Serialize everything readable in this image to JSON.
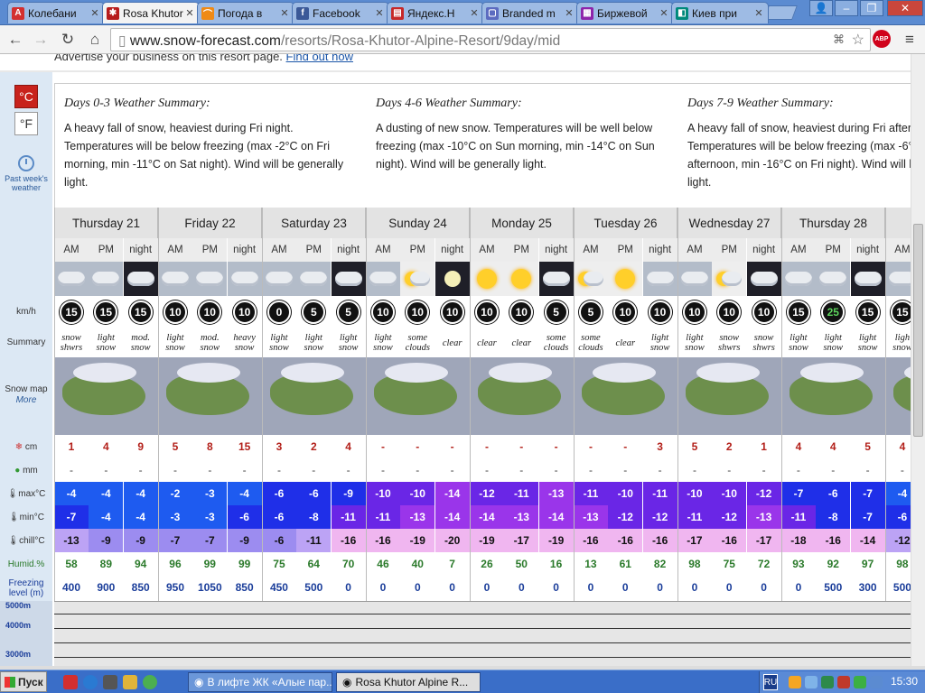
{
  "browser": {
    "tabs": [
      {
        "title": "Колебани",
        "icon": "A",
        "color": "#d32f2f"
      },
      {
        "title": "Rosa Khutor",
        "icon": "✱",
        "color": "#b71c1c"
      },
      {
        "title": "Погода в",
        "icon": "⌒",
        "color": "#ef8a16"
      },
      {
        "title": "Facebook",
        "icon": "f",
        "color": "#3b5998"
      },
      {
        "title": "Яндекс.Н",
        "icon": "▤",
        "color": "#c62828"
      },
      {
        "title": "Branded m",
        "icon": "▢",
        "color": "#5c6bc0"
      },
      {
        "title": "Биржевой",
        "icon": "▦",
        "color": "#8e24aa"
      },
      {
        "title": "Киев при",
        "icon": "◧",
        "color": "#00897b"
      }
    ],
    "url_main": "www.snow-forecast.com",
    "url_path": "/resorts/Rosa-Khutor-Alpine-Resort/9day/mid",
    "window_buttons": [
      "👤",
      "–",
      "❐",
      "✕"
    ],
    "abp_label": "ABP"
  },
  "promo": {
    "text": "Advertise your business on this resort page.",
    "link": "Find out now"
  },
  "units": {
    "c": "°C",
    "f": "°F"
  },
  "past_weather": "Past week's weather",
  "row_labels": {
    "kmh": "km/h",
    "summary": "Summary",
    "snowmap": "Snow map",
    "more": "More",
    "snow": "cm",
    "rain": "mm",
    "max": "max°C",
    "min": "min°C",
    "chill": "chill°C",
    "humid": "Humid.%",
    "freezing": "Freezing level (m)"
  },
  "summaries": [
    {
      "title": "Days 0-3 Weather Summary:",
      "text": "A heavy fall of snow, heaviest during Fri night. Temperatures will be below freezing (max -2°C on Fri morning, min -11°C on Sat night). Wind will be generally light."
    },
    {
      "title": "Days 4-6 Weather Summary:",
      "text": "A dusting of new snow. Temperatures will be well below freezing (max -10°C on Sun morning, min -14°C on Sun night). Wind will be generally light."
    },
    {
      "title": "Days 7-9 Weather Summary:",
      "text": "A heavy fall of snow, heaviest during Fri afternoon. Temperatures will be below freezing (max -6°C on Thu afternoon, min -16°C on Fri night). Wind will be generally light."
    }
  ],
  "days": [
    "Thursday 21",
    "Friday 22",
    "Saturday 23",
    "Sunday 24",
    "Monday 25",
    "Tuesday 26",
    "Wednesday 27",
    "Thursday 28",
    ""
  ],
  "periods": [
    "AM",
    "PM",
    "night",
    "AM",
    "PM",
    "night",
    "AM",
    "PM",
    "night",
    "AM",
    "PM",
    "night",
    "AM",
    "PM",
    "night",
    "AM",
    "PM",
    "night",
    "AM",
    "PM",
    "night",
    "AM",
    "PM",
    "night",
    "AM"
  ],
  "weather_icons": [
    "cloud-snow",
    "cloud-snow",
    "night-snow",
    "cloud-snow",
    "cloud-snow",
    "cloud-heavy-snow",
    "cloud-snow",
    "cloud-snow",
    "night-snow",
    "cloud-snow",
    "sun-cloud",
    "moon",
    "sun",
    "sun",
    "moon-cloud",
    "sun-cloud",
    "sun",
    "cloud-snow",
    "cloud-snow",
    "sun-cloud",
    "moon-snow",
    "cloud-snow",
    "cloud-snow",
    "night-snow",
    "cloud-snow"
  ],
  "wind": [
    "15",
    "15",
    "15",
    "10",
    "10",
    "10",
    "0",
    "5",
    "5",
    "10",
    "10",
    "10",
    "10",
    "10",
    "5",
    "5",
    "10",
    "10",
    "10",
    "10",
    "10",
    "15",
    "25",
    "15",
    "15"
  ],
  "summary_text": [
    "snow shwrs",
    "light snow",
    "mod. snow",
    "light snow",
    "mod. snow",
    "heavy snow",
    "light snow",
    "light snow",
    "light snow",
    "light snow",
    "some clouds",
    "clear",
    "clear",
    "clear",
    "some clouds",
    "some clouds",
    "clear",
    "light snow",
    "light snow",
    "snow shwrs",
    "snow shwrs",
    "light snow",
    "light snow",
    "light snow",
    "ligh snow"
  ],
  "snow_cm": [
    "1",
    "4",
    "9",
    "5",
    "8",
    "15",
    "3",
    "2",
    "4",
    "-",
    "-",
    "-",
    "-",
    "-",
    "-",
    "-",
    "-",
    "3",
    "5",
    "2",
    "1",
    "4",
    "4",
    "5",
    "4"
  ],
  "rain_mm": [
    "-",
    "-",
    "-",
    "-",
    "-",
    "-",
    "-",
    "-",
    "-",
    "-",
    "-",
    "-",
    "-",
    "-",
    "-",
    "-",
    "-",
    "-",
    "-",
    "-",
    "-",
    "-",
    "-",
    "-",
    "-"
  ],
  "max_c": [
    "-4",
    "-4",
    "-4",
    "-2",
    "-3",
    "-4",
    "-6",
    "-6",
    "-9",
    "-10",
    "-10",
    "-14",
    "-12",
    "-11",
    "-13",
    "-11",
    "-10",
    "-11",
    "-10",
    "-10",
    "-12",
    "-7",
    "-6",
    "-7",
    "-4"
  ],
  "min_c": [
    "-7",
    "-4",
    "-4",
    "-3",
    "-3",
    "-6",
    "-6",
    "-8",
    "-11",
    "-11",
    "-13",
    "-14",
    "-14",
    "-13",
    "-14",
    "-13",
    "-12",
    "-12",
    "-11",
    "-12",
    "-13",
    "-11",
    "-8",
    "-7",
    "-6"
  ],
  "chill_c": [
    "-13",
    "-9",
    "-9",
    "-7",
    "-7",
    "-9",
    "-6",
    "-11",
    "-16",
    "-16",
    "-19",
    "-20",
    "-19",
    "-17",
    "-19",
    "-16",
    "-16",
    "-16",
    "-17",
    "-16",
    "-17",
    "-18",
    "-16",
    "-14",
    "-12"
  ],
  "humid": [
    "58",
    "89",
    "94",
    "96",
    "99",
    "99",
    "75",
    "64",
    "70",
    "46",
    "40",
    "7",
    "26",
    "50",
    "16",
    "13",
    "61",
    "82",
    "98",
    "75",
    "72",
    "93",
    "92",
    "97",
    "98"
  ],
  "freezing": [
    "400",
    "900",
    "850",
    "950",
    "1050",
    "850",
    "450",
    "500",
    "0",
    "0",
    "0",
    "0",
    "0",
    "0",
    "0",
    "0",
    "0",
    "0",
    "0",
    "0",
    "0",
    "0",
    "500",
    "300",
    "500"
  ],
  "freezing_scale": [
    "5000m",
    "4000m",
    "3000m",
    "2000m"
  ],
  "taskbar": {
    "start": "Пуск",
    "windows": [
      "В лифте ЖК «Алые пар...",
      "Rosa Khutor Alpine R..."
    ],
    "lang": "RU",
    "time": "15:30"
  }
}
